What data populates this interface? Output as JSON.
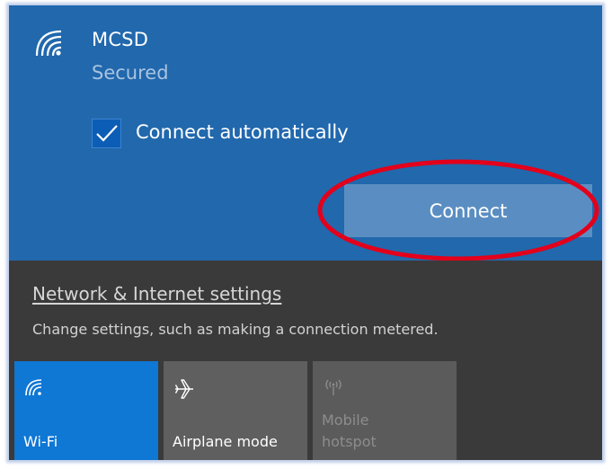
{
  "network": {
    "name": "MCSD",
    "status": "Secured",
    "connect_automatically_label": "Connect automatically",
    "connect_automatically_checked": true,
    "connect_button_label": "Connect",
    "icon": "wifi-icon"
  },
  "settings": {
    "link_label": "Network & Internet settings",
    "description": "Change settings, such as making a connection metered."
  },
  "quick_actions": [
    {
      "label": "Wi-Fi",
      "icon": "wifi-icon",
      "active": true
    },
    {
      "label": "Airplane mode",
      "icon": "airplane-icon",
      "active": false
    },
    {
      "label": "Mobile hotspot",
      "icon": "hotspot-icon",
      "active": false,
      "disabled": true
    }
  ],
  "colors": {
    "network_panel_bg": "#2168ad",
    "settings_panel_bg": "#3a3a3a",
    "accent_tile": "#0f77d4",
    "inactive_tile": "#5f5f5f",
    "connect_button": "#5a8ec2",
    "annotation": "#e3001b"
  }
}
